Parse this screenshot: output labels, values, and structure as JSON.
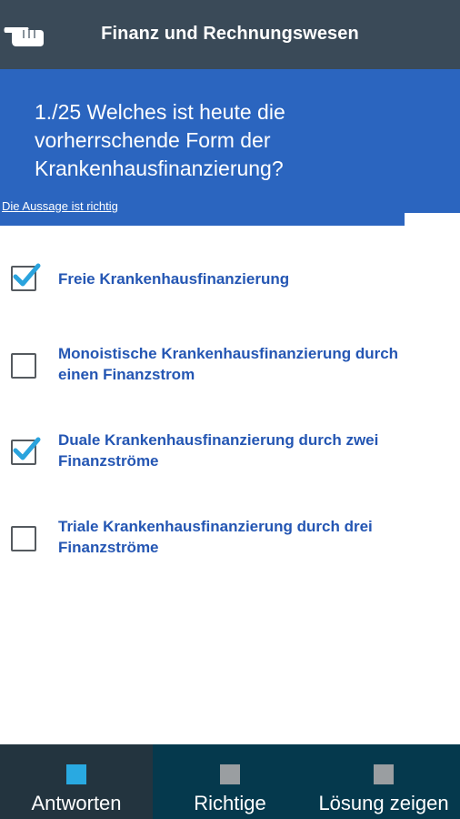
{
  "header": {
    "title": "Finanz und Rechnungswesen"
  },
  "question": {
    "text": "1./25 Welches ist heute die vorherrschende Form der Krankenhausfinanzierung?",
    "hint": "Die Aussage ist richtig",
    "progress": 0.88
  },
  "options": [
    {
      "label": "Freie Krankenhausfinanzierung",
      "checked": true
    },
    {
      "label": "Monoistische Krankenhausfinanzierung durch einen Finanzstrom",
      "checked": false
    },
    {
      "label": "Duale Krankenhausfinanzierung durch zwei Finanzströme",
      "checked": true
    },
    {
      "label": "Triale Krankenhausfinanzierung durch drei Finanzströme",
      "checked": false
    }
  ],
  "bottom_nav": {
    "tabs": [
      {
        "label": "Antworten",
        "active": true,
        "indicator_color": "#29a9e1"
      },
      {
        "label": "Richtige",
        "active": false,
        "indicator_color": "#9a9ea1"
      },
      {
        "label": "Lösung zeigen",
        "active": false,
        "indicator_color": "#9a9ea1"
      }
    ]
  },
  "colors": {
    "topbar": "#3a4a58",
    "question_bg": "#2b65bf",
    "option_text": "#2456b3",
    "check": "#2aa3dd",
    "bottom_nav": "#05394d"
  },
  "icons": {
    "back": "pointing-hand-icon",
    "checkmark": "checkmark-icon"
  }
}
